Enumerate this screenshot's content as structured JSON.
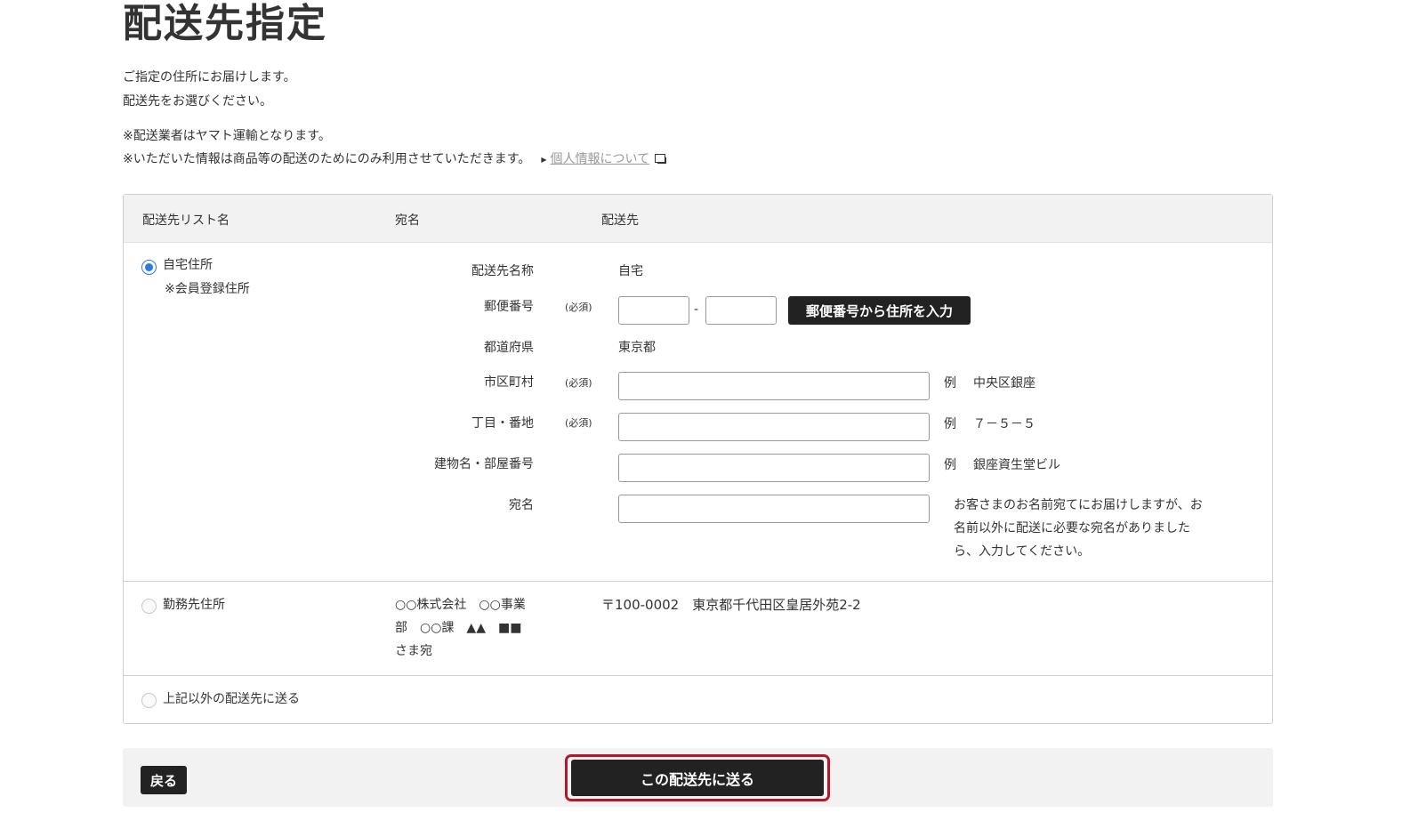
{
  "page": {
    "title": "配送先指定",
    "intro_lines": [
      "ご指定の住所にお届けします。",
      "配送先をお選びください。"
    ],
    "note_lines": [
      "※配送業者はヤマト運輸となります。",
      "※いただいた情報は商品等の配送のためにのみ利用させていただきます。"
    ],
    "privacy_link": "個人情報について"
  },
  "table": {
    "headers": {
      "list_name": "配送先リスト名",
      "recipient": "宛名",
      "destination": "配送先"
    },
    "home": {
      "label": "自宅住所",
      "sublabel": "※会員登録住所",
      "selected": true,
      "form": {
        "name_label": "配送先名称",
        "name_value": "自宅",
        "postal_label": "郵便番号",
        "required_mark": "(必須)",
        "postal_sep": "-",
        "postal_button": "郵便番号から住所を入力",
        "pref_label": "都道府県",
        "pref_value": "東京都",
        "city_label": "市区町村",
        "city_example_prefix": "例",
        "city_example": "中央区銀座",
        "block_label": "丁目・番地",
        "block_example_prefix": "例",
        "block_example": "７－５－５",
        "building_label": "建物名・部屋番号",
        "building_example_prefix": "例",
        "building_example": "銀座資生堂ビル",
        "recipient_label": "宛名",
        "recipient_note_lines": [
          "お客さまのお名前宛てにお届けしますが、お",
          "名前以外に配送に必要な宛名がありました",
          "ら、入力してください。"
        ]
      }
    },
    "work": {
      "label": "勤務先住所",
      "selected": false,
      "recipient_lines": [
        "○○株式会社　○○事業",
        "部　○○課　▲▲　■■",
        "さま宛"
      ],
      "address": "〒100-0002　東京都千代田区皇居外苑2-2"
    },
    "other": {
      "label": "上記以外の配送先に送る",
      "selected": false
    }
  },
  "footer": {
    "back_button": "戻る",
    "submit_button": "この配送先に送る"
  }
}
